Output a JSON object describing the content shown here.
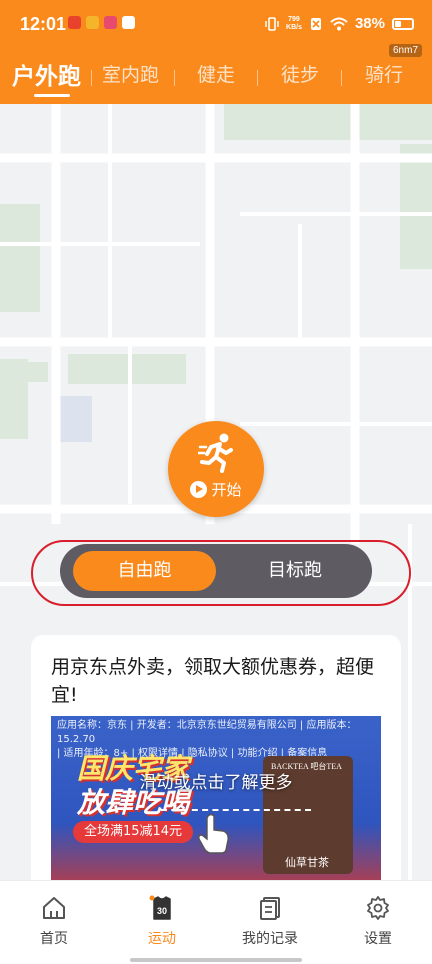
{
  "status_bar": {
    "time": "12:01",
    "speed_value": "799",
    "speed_unit": "KB/s",
    "battery": "38%",
    "corner_tag": "6nm7"
  },
  "tabs": [
    {
      "label": "户外跑",
      "active": true
    },
    {
      "label": "室内跑",
      "active": false
    },
    {
      "label": "健走",
      "active": false
    },
    {
      "label": "徒步",
      "active": false
    },
    {
      "label": "骑行",
      "active": false
    }
  ],
  "start_button": {
    "label": "开始"
  },
  "modes": {
    "free": "自由跑",
    "target": "目标跑"
  },
  "ad": {
    "title": "用京东点外卖，领取大额优惠券，超便宜!",
    "meta_line1": "应用名称：京东 | 开发者：北京京东世纪贸易有限公司 | 应用版本：15.2.70",
    "meta_line2": "| 适用年龄：8+ | 权限详情 | 隐私协议 | 功能介绍 | 备案信息",
    "version": "15.2.70",
    "headline_1": "国庆宅家",
    "headline_2": "放肆吃喝",
    "promo": "全场满15减14元",
    "drink_brand": "BACKTEA 吧台TEA",
    "drink_name": "仙草甘茶",
    "overlay": "滑动或点击了解更多"
  },
  "bottom_nav": [
    {
      "label": "首页",
      "icon": "home-icon",
      "active": false
    },
    {
      "label": "运动",
      "icon": "sport-jersey-icon",
      "badge": "30",
      "active": true
    },
    {
      "label": "我的记录",
      "icon": "records-icon",
      "active": false
    },
    {
      "label": "设置",
      "icon": "settings-icon",
      "active": false
    }
  ],
  "colors": {
    "accent": "#fb8a1c",
    "selector_bg": "#5e5b63",
    "highlight_outline": "#d81e2a"
  }
}
